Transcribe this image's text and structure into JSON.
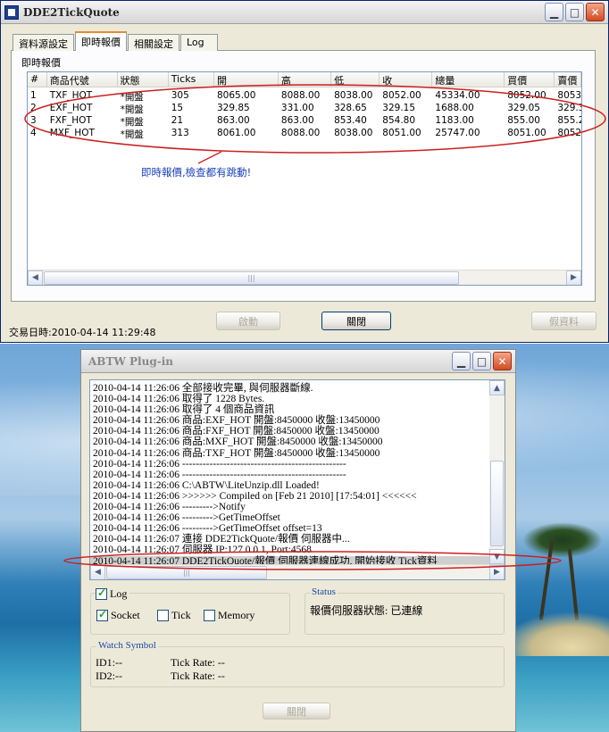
{
  "main_window": {
    "title": "DDE2TickQuote",
    "tabs": [
      "資料源設定",
      "即時報價",
      "相關設定",
      "Log"
    ],
    "active_tab": "即時報價",
    "panel_title": "即時報價",
    "columns": [
      "#",
      "商品代號",
      "狀態",
      "Ticks",
      "開",
      "高",
      "低",
      "收",
      "總量",
      "買價",
      "賣價"
    ],
    "rows": [
      [
        "1",
        "TXF_HOT",
        "*開盤",
        "305",
        "8065.00",
        "8088.00",
        "8038.00",
        "8052.00",
        "45334.00",
        "8052.00",
        "8053"
      ],
      [
        "2",
        "EXF_HOT",
        "*開盤",
        "15",
        "329.85",
        "331.00",
        "328.65",
        "329.15",
        "1688.00",
        "329.05",
        "329.3"
      ],
      [
        "3",
        "FXF_HOT",
        "*開盤",
        "21",
        "863.00",
        "863.00",
        "853.40",
        "854.80",
        "1183.00",
        "855.00",
        "855.2"
      ],
      [
        "4",
        "MXF_HOT",
        "*開盤",
        "313",
        "8061.00",
        "8088.00",
        "8038.00",
        "8051.00",
        "25747.00",
        "8051.00",
        "8052"
      ]
    ],
    "annotation": "即時報價,檢查都有跳動!",
    "buttons": {
      "start": "啟動",
      "close": "關閉",
      "fake_data": "假資料"
    },
    "status_time": "交易日時:2010-04-14  11:29:48"
  },
  "plugin_window": {
    "title": "ABTW Plug-in",
    "log_lines": [
      "2010-04-14 11:26:06 全部接收完畢, 與伺服器斷線.",
      "2010-04-14 11:26:06 取得了 1228 Bytes.",
      "2010-04-14 11:26:06    取得了 4 個商品資訊",
      "2010-04-14 11:26:06    商品:EXF_HOT 開盤:8450000 收盤:13450000",
      "2010-04-14 11:26:06    商品:FXF_HOT 開盤:8450000 收盤:13450000",
      "2010-04-14 11:26:06    商品:MXF_HOT 開盤:8450000 收盤:13450000",
      "2010-04-14 11:26:06    商品:TXF_HOT 開盤:8450000 收盤:13450000",
      "2010-04-14 11:26:06 ------------------------------------------------",
      "2010-04-14 11:26:06 ------------------------------------------------",
      "2010-04-14 11:26:06 C:\\ABTW\\LiteUnzip.dll Loaded!",
      "2010-04-14 11:26:06 >>>>>> Compiled on [Feb 21 2010] [17:54:01] <<<<<<",
      "2010-04-14 11:26:06 --------->Notify",
      "2010-04-14 11:26:06 --------->GetTimeOffset",
      "2010-04-14 11:26:06 --------->GetTimeOffset offset=13",
      "2010-04-14 11:26:07 連接 DDE2TickQuote/報價 伺服器中...",
      "2010-04-14 11:26:07 伺服器 IP:127.0.0.1, Port:4568",
      "2010-04-14 11:26:07 DDE2TickQuote/報價 伺服器連線成功, 開始接收 Tick資料"
    ],
    "checkboxes": {
      "log": {
        "label": "Log",
        "checked": true
      },
      "socket": {
        "label": "Socket",
        "checked": true
      },
      "tick": {
        "label": "Tick",
        "checked": false
      },
      "memory": {
        "label": "Memory",
        "checked": false
      }
    },
    "status": {
      "title": "Status",
      "text": "報價伺服器狀態: 已連線"
    },
    "watch": {
      "title": "Watch Symbol",
      "id1": "ID1:--",
      "id2": "ID2:--",
      "rate1": "Tick Rate: --",
      "rate2": "Tick Rate: --"
    },
    "close_button": "關閉"
  },
  "colors": {
    "annotation": "#1a3fb8",
    "ellipse": "#cc2020"
  }
}
